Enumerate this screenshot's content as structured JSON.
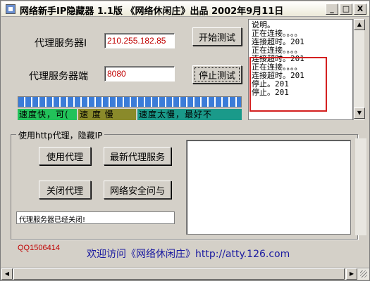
{
  "window": {
    "title": "网络新手IP隐藏器 1.1版 《网络休闲庄》出品 2002年9月11日",
    "minimize_label": "_",
    "maximize_label": "□",
    "close_label": "X"
  },
  "proxy": {
    "server_label": "代理服务器I",
    "server_value": "210.255.182.85",
    "port_label": "代理服务器端",
    "port_value": "8080",
    "start_test_label": "开始测试",
    "stop_test_label": "停止测试"
  },
  "log": {
    "lines": [
      "说明。",
      "正在连接。。。。",
      "连接超时。201",
      "正在连接。。。。",
      "连接超时。201",
      "正在连接。。。。",
      "连接超时。201",
      "停止。201",
      "停止。201"
    ]
  },
  "progress": {
    "fill_percent": 100
  },
  "speed_legend": [
    {
      "label": "速度快，可(",
      "color": "#22c25a"
    },
    {
      "label": "速 度 慢",
      "color": "#8a8a2a"
    },
    {
      "label": "速度太慢，最好不",
      "color": "#1a9a8a"
    }
  ],
  "http_group": {
    "title": "使用http代理，隐藏IP",
    "use_proxy_label": "使用代理",
    "latest_proxy_label": "最新代理服务",
    "close_proxy_label": "关闭代理",
    "network_safety_label": "网络安全问与",
    "status_text": "代理服务器已经关闭!"
  },
  "footer": {
    "qq": "QQ1506414",
    "welcome": "欢迎访问《网络休闲庄》http://atty.126.com"
  },
  "icons": {
    "scroll_up": "▲",
    "scroll_down": "▼",
    "scroll_left": "◀",
    "scroll_right": "▶"
  }
}
